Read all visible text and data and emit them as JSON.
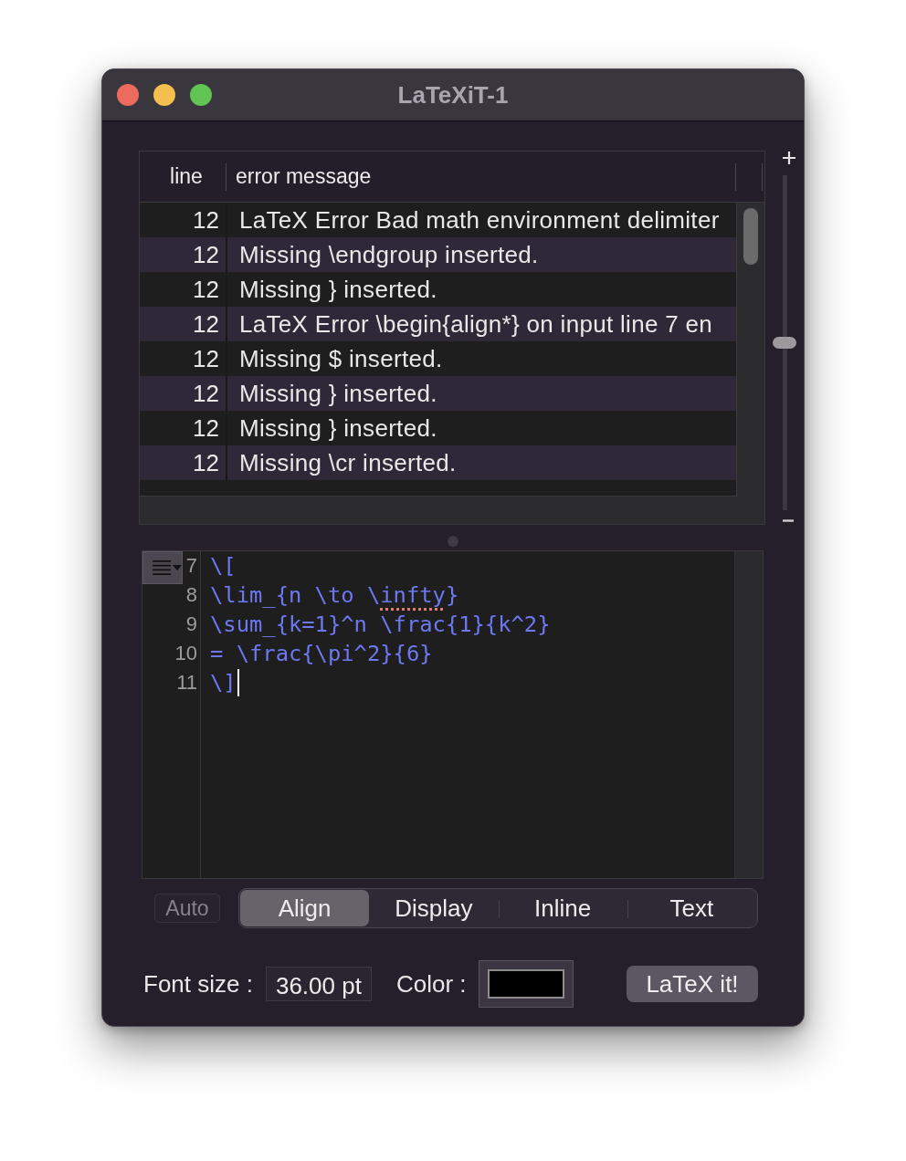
{
  "window": {
    "title": "LaTeXiT-1"
  },
  "errors_table": {
    "columns": [
      "line",
      "error message"
    ],
    "rows": [
      {
        "line": "12",
        "message": "LaTeX Error Bad math environment delimiter"
      },
      {
        "line": "12",
        "message": "Missing \\endgroup inserted."
      },
      {
        "line": "12",
        "message": "Missing } inserted."
      },
      {
        "line": "12",
        "message": "LaTeX Error \\begin{align*} on input line 7 en"
      },
      {
        "line": "12",
        "message": "Missing $ inserted."
      },
      {
        "line": "12",
        "message": "Missing } inserted."
      },
      {
        "line": "12",
        "message": "Missing } inserted."
      },
      {
        "line": "12",
        "message": "Missing \\cr inserted."
      }
    ]
  },
  "slider": {
    "level": 0.5
  },
  "editor": {
    "lines": [
      {
        "number": "7",
        "cursor": false,
        "spans": [
          {
            "text": "\\[",
            "misspelled": false
          }
        ]
      },
      {
        "number": "8",
        "cursor": false,
        "spans": [
          {
            "text": "\\lim_{n \\to \\",
            "misspelled": false
          },
          {
            "text": "infty",
            "misspelled": true
          },
          {
            "text": "}",
            "misspelled": false
          }
        ]
      },
      {
        "number": "9",
        "cursor": false,
        "spans": [
          {
            "text": "\\sum_{k=1}^n \\frac{1}{k^2}",
            "misspelled": false
          }
        ]
      },
      {
        "number": "10",
        "cursor": false,
        "spans": [
          {
            "text": "= \\frac{\\pi^2}{6}",
            "misspelled": false
          }
        ]
      },
      {
        "number": "11",
        "cursor": true,
        "spans": [
          {
            "text": "\\]",
            "misspelled": false
          }
        ]
      }
    ]
  },
  "modes": {
    "auto": {
      "label": "Auto",
      "disabled": true
    },
    "segments": [
      {
        "label": "Align",
        "selected": true
      },
      {
        "label": "Display",
        "selected": false
      },
      {
        "label": "Inline",
        "selected": false
      },
      {
        "label": "Text",
        "selected": false
      }
    ]
  },
  "font_size": {
    "label": "Font size :",
    "value": "36.00 pt"
  },
  "color": {
    "label": "Color :",
    "color": "#000000"
  },
  "latex_button": {
    "label": "LaTeX it!"
  }
}
